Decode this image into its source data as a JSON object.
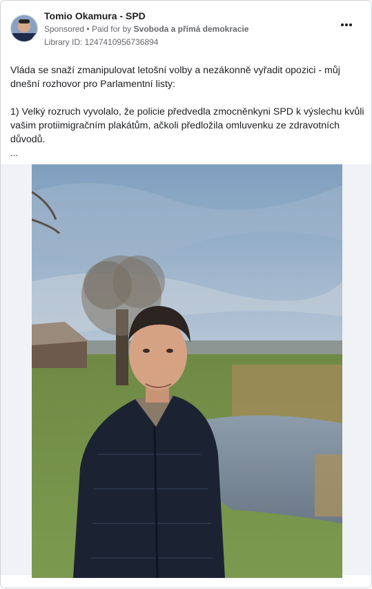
{
  "post": {
    "author": "Tomio Okamura - SPD",
    "sponsored": "Sponsored",
    "paid_for_prefix": "Paid for by",
    "paid_for_by": "Svoboda a přímá demokracie",
    "library_id": "Library ID: 1247410956736894",
    "paragraph_1": "Vláda se snaží zmanipulovat letošní volby a nezákonně vyřadit opozici - můj dnešní rozhovor pro Parlamentní listy:",
    "paragraph_2": "1) Velký rozruch vyvolalo, že policie předvedla zmocněnkyni SPD k výslechu kvůli vašim protiimigračním plakátům, ačkoli předložila omluvenku ze zdravotních důvodů.",
    "ellipsis": "..."
  },
  "icons": {
    "more": "more-options-icon",
    "avatar": "profile-avatar"
  }
}
